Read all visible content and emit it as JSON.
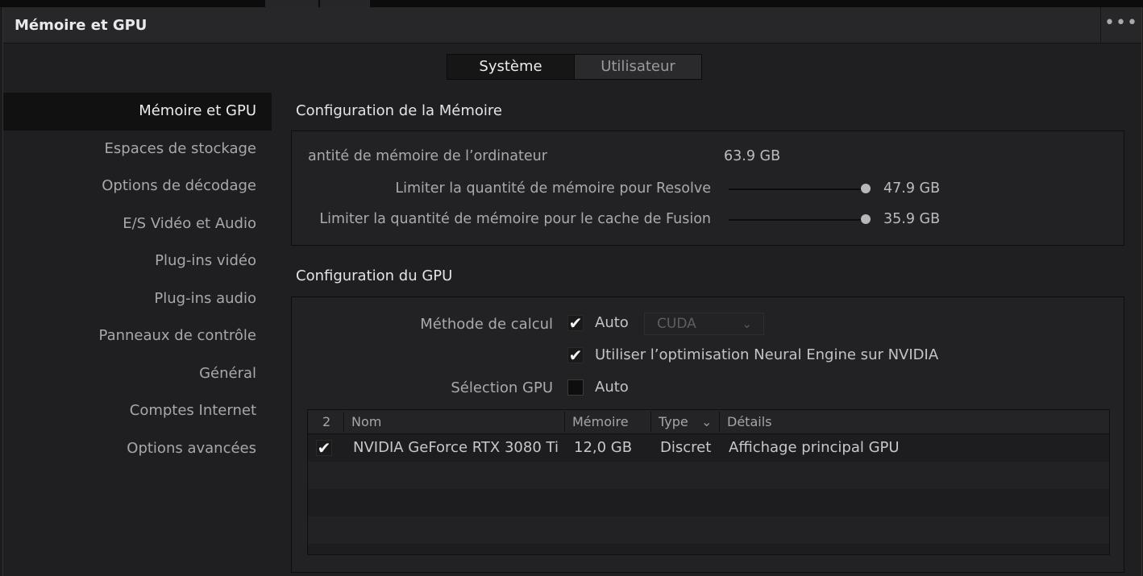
{
  "window": {
    "title": "Mémoire et GPU",
    "menu_label": "•••"
  },
  "segment": {
    "system": "Système",
    "user": "Utilisateur"
  },
  "sidebar": {
    "items": [
      {
        "label": "Mémoire et GPU"
      },
      {
        "label": "Espaces de stockage"
      },
      {
        "label": "Options de décodage"
      },
      {
        "label": "E/S Vidéo et Audio"
      },
      {
        "label": "Plug-ins vidéo"
      },
      {
        "label": "Plug-ins audio"
      },
      {
        "label": "Panneaux de contrôle"
      },
      {
        "label": "Général"
      },
      {
        "label": "Comptes Internet"
      },
      {
        "label": "Options avancées"
      }
    ]
  },
  "memory": {
    "title": "Configuration de la Mémoire",
    "computer_label": "antité de mémoire de l’ordinateur",
    "computer_value": "63.9 GB",
    "resolve_label": "Limiter la quantité de mémoire pour Resolve",
    "resolve_value": "47.9 GB",
    "resolve_fraction": 1.0,
    "fusion_label": "Limiter la quantité de mémoire pour le cache de Fusion",
    "fusion_value": "35.9 GB",
    "fusion_fraction": 1.0
  },
  "gpu": {
    "title": "Configuration du GPU",
    "method_label": "Méthode de calcul",
    "method_auto_label": "Auto",
    "method_auto_checked": true,
    "method_select_value": "CUDA",
    "neural_label": "Utiliser l’optimisation Neural Engine sur NVIDIA",
    "neural_checked": true,
    "selection_label": "Sélection GPU",
    "selection_auto_label": "Auto",
    "selection_auto_checked": false,
    "table": {
      "headers": {
        "count": "2",
        "name": "Nom",
        "memory": "Mémoire",
        "type": "Type",
        "details": "Détails"
      },
      "rows": [
        {
          "checked": true,
          "name": "NVIDIA GeForce RTX 3080 Ti",
          "memory": "12,0 GB",
          "type": "Discret",
          "details": "Affichage principal GPU"
        }
      ]
    }
  },
  "icons": {
    "check": "checkmark-icon",
    "chevron": "chevron-down-icon",
    "more": "more-dots-icon"
  }
}
